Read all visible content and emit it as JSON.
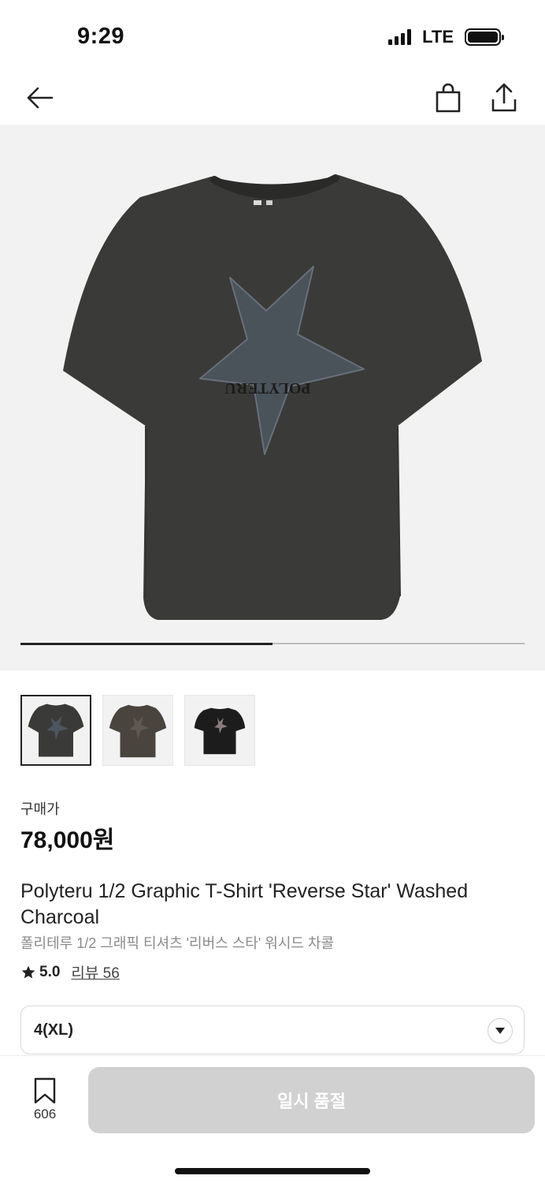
{
  "status_bar": {
    "time": "9:29",
    "network": "LTE",
    "icons": [
      "signal-icon",
      "battery-icon"
    ]
  },
  "nav": {
    "icons": [
      "back-arrow-icon",
      "shopping-bag-icon",
      "share-icon"
    ]
  },
  "gallery": {
    "image_count": 3,
    "active_index": 0,
    "progress_fraction": 0.5
  },
  "price": {
    "label": "구매가",
    "value": "78,000원"
  },
  "product": {
    "title_en": "Polyteru 1/2 Graphic T-Shirt 'Reverse Star' Washed Charcoal",
    "title_ko": "폴리테루 1/2 그래픽 티셔츠 '리버스 스타' 워시드 차콜"
  },
  "rating": {
    "score": "5.0",
    "review_link": "리뷰 56",
    "icon": "star-icon"
  },
  "size_option": {
    "selected": "4(XL)",
    "icon": "chevron-down-icon"
  },
  "bottom_bar": {
    "wish_count": "606",
    "buy_label": "일시 품절",
    "icon": "bookmark-icon"
  },
  "colors": {
    "accent": "#222222",
    "disabled_button": "#d1d1d1",
    "hero_bg": "#f2f2f2",
    "shirt": "#3b3b39"
  }
}
